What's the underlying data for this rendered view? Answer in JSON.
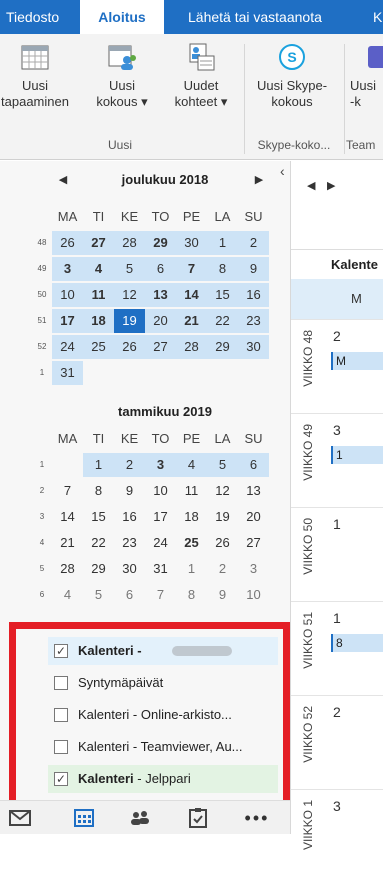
{
  "ribbon": {
    "tabs": [
      {
        "label": "Tiedosto",
        "active": false
      },
      {
        "label": "Aloitus",
        "active": true
      },
      {
        "label": "Lähetä tai vastaanota",
        "active": false
      },
      {
        "label": "K",
        "active": false
      }
    ],
    "buttons": [
      {
        "line1": "Uusi",
        "line2": "tapaaminen",
        "icon": "calendar-grid-icon"
      },
      {
        "line1": "Uusi",
        "line2": "kokous ▾",
        "icon": "meeting-people-icon"
      },
      {
        "line1": "Uudet",
        "line2": "kohteet ▾",
        "icon": "new-items-icon"
      },
      {
        "line1": "Uusi Skype-",
        "line2": "kokous",
        "icon": "skype-icon"
      },
      {
        "line1": "Uusi",
        "line2": "-k",
        "icon": "teams-icon"
      }
    ],
    "groups": [
      "Uusi",
      "Skype-koko...",
      "Team"
    ]
  },
  "collapse_arrow": "‹",
  "calendars": [
    {
      "month": "joulukuu 2018",
      "prev": "◀",
      "next": "▶",
      "dow": [
        "MA",
        "TI",
        "KE",
        "TO",
        "PE",
        "LA",
        "SU"
      ],
      "weeks": [
        {
          "wk": "48",
          "days": [
            "26",
            "27",
            "28",
            "29",
            "30",
            "1",
            "2"
          ]
        },
        {
          "wk": "49",
          "days": [
            "3",
            "4",
            "5",
            "6",
            "7",
            "8",
            "9"
          ]
        },
        {
          "wk": "50",
          "days": [
            "10",
            "11",
            "12",
            "13",
            "14",
            "15",
            "16"
          ]
        },
        {
          "wk": "51",
          "days": [
            "17",
            "18",
            "19",
            "20",
            "21",
            "22",
            "23"
          ]
        },
        {
          "wk": "52",
          "days": [
            "24",
            "25",
            "26",
            "27",
            "28",
            "29",
            "30"
          ]
        },
        {
          "wk": "1",
          "days": [
            "31",
            "",
            "",
            "",
            "",
            "",
            ""
          ]
        }
      ]
    },
    {
      "month": "tammikuu 2019",
      "dow": [
        "MA",
        "TI",
        "KE",
        "TO",
        "PE",
        "LA",
        "SU"
      ],
      "weeks": [
        {
          "wk": "1",
          "days": [
            "",
            "1",
            "2",
            "3",
            "4",
            "5",
            "6"
          ]
        },
        {
          "wk": "2",
          "days": [
            "7",
            "8",
            "9",
            "10",
            "11",
            "12",
            "13"
          ]
        },
        {
          "wk": "3",
          "days": [
            "14",
            "15",
            "16",
            "17",
            "18",
            "19",
            "20"
          ]
        },
        {
          "wk": "4",
          "days": [
            "21",
            "22",
            "23",
            "24",
            "25",
            "26",
            "27"
          ]
        },
        {
          "wk": "5",
          "days": [
            "28",
            "29",
            "30",
            "31",
            "1",
            "2",
            "3"
          ]
        },
        {
          "wk": "6",
          "days": [
            "4",
            "5",
            "6",
            "7",
            "8",
            "9",
            "10"
          ]
        }
      ]
    }
  ],
  "calendar_list": [
    {
      "label": "Kalenteri -",
      "checked": true,
      "bold": true
    },
    {
      "label": "Syntymäpäivät",
      "checked": false,
      "bold": false
    },
    {
      "label": "Kalenteri - Online-arkisto...",
      "checked": false,
      "bold": false
    },
    {
      "label": "Kalenteri - Teamviewer, Au...",
      "checked": false,
      "bold": false
    },
    {
      "label_bold": "Kalenteri",
      "label_rest": " - Jelppari",
      "checked": true,
      "bold": true
    }
  ],
  "bottom_nav": [
    "mail-icon",
    "calendar-icon",
    "people-icon",
    "tasks-icon",
    "more-icon"
  ],
  "right_pane": {
    "nav_prev": "◀",
    "nav_next": "▶",
    "header": "Kalente",
    "subheader": "M",
    "weeks": [
      {
        "label": "VIIKKO 48",
        "num": "2",
        "event": "M"
      },
      {
        "label": "VIIKKO 49",
        "num": "3",
        "event": "1"
      },
      {
        "label": "VIIKKO 50",
        "num": "1",
        "event": ""
      },
      {
        "label": "VIIKKO 51",
        "num": "1",
        "event": "8"
      },
      {
        "label": "VIIKKO 52",
        "num": "2",
        "event": ""
      },
      {
        "label": "VIIKKO 1",
        "num": "3",
        "event": ""
      }
    ]
  },
  "colors": {
    "accent": "#1f6fc4",
    "highlight": "#cde3f6",
    "red_outline": "#e41e26",
    "selected_row": "#e3f1fb",
    "green_row": "#e3f3e3"
  }
}
